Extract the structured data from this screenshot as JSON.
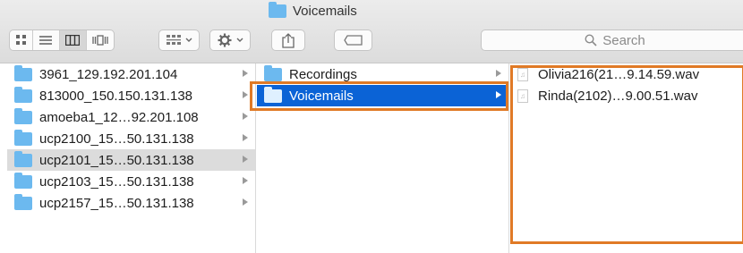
{
  "window": {
    "title": "Voicemails"
  },
  "toolbar": {
    "view_icons": [
      "icon-view-icon",
      "list-view-icon",
      "column-view-icon",
      "cover-flow-icon"
    ],
    "search_placeholder": "Search"
  },
  "column1": {
    "items": [
      {
        "label": "3961_129.192.201.104",
        "state": "normal"
      },
      {
        "label": "813000_150.150.131.138",
        "state": "normal"
      },
      {
        "label": "amoeba1_12…92.201.108",
        "state": "normal"
      },
      {
        "label": "ucp2100_15…50.131.138",
        "state": "normal"
      },
      {
        "label": "ucp2101_15…50.131.138",
        "state": "grey"
      },
      {
        "label": "ucp2103_15…50.131.138",
        "state": "normal"
      },
      {
        "label": "ucp2157_15…50.131.138",
        "state": "normal"
      }
    ]
  },
  "column2": {
    "items": [
      {
        "label": "Recordings",
        "state": "normal"
      },
      {
        "label": "Voicemails",
        "state": "selected"
      }
    ]
  },
  "column3": {
    "items": [
      {
        "label": "Olivia216(21…9.14.59.wav"
      },
      {
        "label": "Rinda(2102)…9.00.51.wav"
      }
    ]
  },
  "colors": {
    "accent": "#0b63d6",
    "highlight": "#e07a26",
    "folder": "#6cb9ef"
  }
}
